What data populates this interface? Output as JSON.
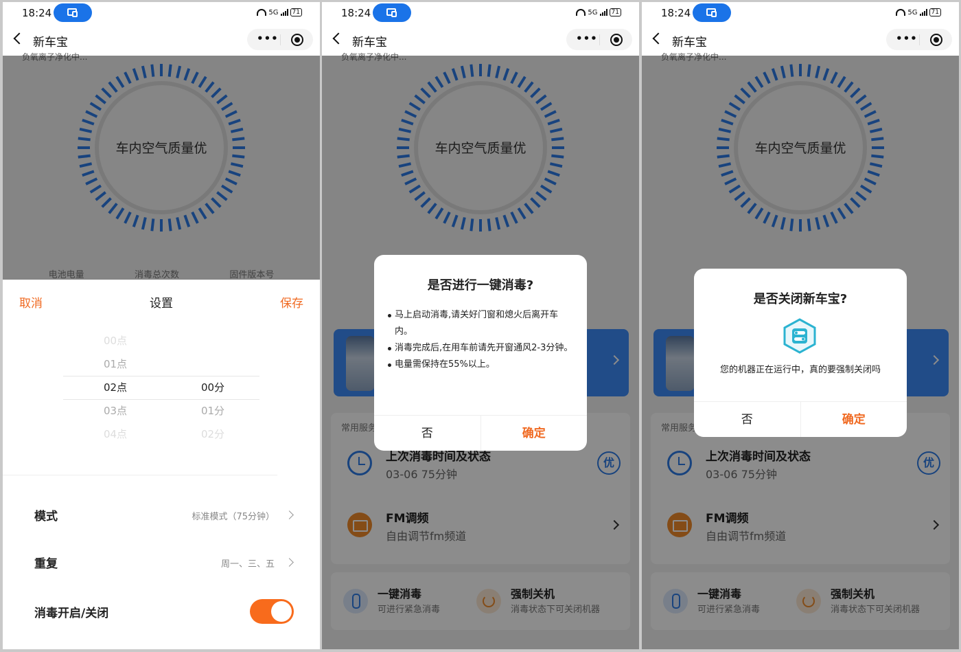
{
  "status": {
    "time": "18:24",
    "battery": "71",
    "network": "5G"
  },
  "nav": {
    "title": "新车宝"
  },
  "main": {
    "clipped_text": "负氧离子净化中...",
    "gauge_label": "车内空气质量优",
    "stats": [
      {
        "label": "电池电量"
      },
      {
        "label": "消毒总次数"
      },
      {
        "label": "固件版本号"
      }
    ],
    "services_title": "常用服务",
    "last_disinfect": {
      "title": "上次消毒时间及状态",
      "sub": "03-06   75分钟",
      "badge": "优"
    },
    "fm": {
      "title": "FM调频",
      "sub": "自由调节fm频道"
    },
    "quick": [
      {
        "title": "一键消毒",
        "sub": "可进行紧急消毒"
      },
      {
        "title": "强制关机",
        "sub": "消毒状态下可关闭机器"
      }
    ]
  },
  "sheet": {
    "cancel": "取消",
    "title": "设置",
    "save": "保存",
    "hours": [
      "00点",
      "01点",
      "02点",
      "03点",
      "04点"
    ],
    "minutes": [
      "00分",
      "01分",
      "02分"
    ],
    "selected_hour": "02点",
    "selected_minute": "00分",
    "mode_label": "模式",
    "mode_value": "标准模式（75分钟）",
    "repeat_label": "重复",
    "repeat_value": "周一、三、五",
    "toggle_label": "消毒开启/关闭",
    "toggle_on": true
  },
  "dialog_disinfect": {
    "title": "是否进行一键消毒?",
    "bullets": [
      "马上启动消毒,请关好门窗和熄火后离开车内。",
      "消毒完成后,在用车前请先开窗通风2-3分钟。",
      "电量需保持在55%以上。"
    ],
    "no": "否",
    "yes": "确定"
  },
  "dialog_shutdown": {
    "title": "是否关闭新车宝?",
    "message": "您的机器正在运行中，真的要强制关闭吗",
    "no": "否",
    "yes": "确定"
  },
  "colors": {
    "accent": "#f06a22",
    "primary": "#2d7be6",
    "toggle": "#f86b1c"
  }
}
